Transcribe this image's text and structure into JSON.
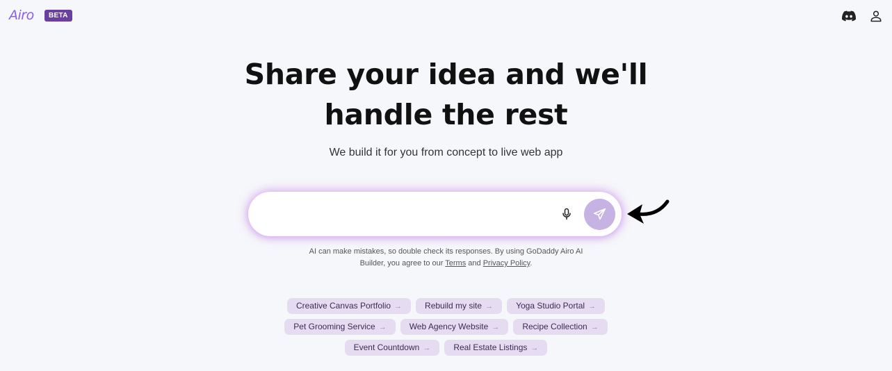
{
  "header": {
    "logo_text": "Airo",
    "badge": "BETA",
    "icons": [
      "discord-icon",
      "user-icon"
    ]
  },
  "hero": {
    "headline_line1": "Share your idea and we'll",
    "headline_line2": "handle the rest",
    "subheadline": "We build it for you from concept to live web app"
  },
  "prompt": {
    "value": "",
    "placeholder": ""
  },
  "disclaimer": {
    "line1": "AI can make mistakes, so double check its responses. By using GoDaddy Airo AI",
    "line2_prefix": "Builder, you agree to our",
    "terms_link": "Terms",
    "and": "and",
    "privacy_link": "Privacy Policy",
    "suffix": "."
  },
  "suggestions": [
    [
      "Creative Canvas Portfolio",
      "Rebuild my site",
      "Yoga Studio Portal"
    ],
    [
      "Pet Grooming Service",
      "Web Agency Website",
      "Recipe Collection"
    ],
    [
      "Event Countdown",
      "Real Estate Listings"
    ]
  ],
  "chip_arrow": "→",
  "colors": {
    "brand": "#8a5cf6",
    "badge_bg": "#6b3fa0",
    "chip_bg": "#e6dcf2",
    "send_bg": "#c6b2e3",
    "glow": "#ce8cee"
  }
}
